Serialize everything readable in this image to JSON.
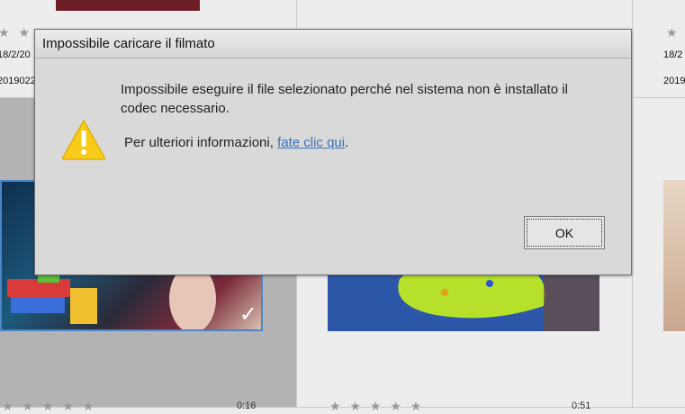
{
  "dialog": {
    "title": "Impossibile caricare il filmato",
    "message": "Impossibile eseguire il file selezionato perché nel sistema non è installato il codec necessario.",
    "info_prefix": "Per ulteriori informazioni, ",
    "info_link": "fate clic qui",
    "info_suffix": ".",
    "ok_label": "OK",
    "icon": "warning-icon"
  },
  "background": {
    "cells": [
      {
        "date": "18/2/20",
        "filename": "2019022",
        "stars": "★ ★"
      },
      {
        "date": "18/2",
        "filename": "2019",
        "stars": "★"
      }
    ],
    "rating_row": "★ ★ ★ ★ ★",
    "durations": [
      "0:16",
      "0:51"
    ]
  },
  "colors": {
    "dialog_bg": "#d9d9d9",
    "link": "#3a6fb0",
    "warning_yellow": "#f7cb17",
    "selection_check": "#ffffff"
  }
}
